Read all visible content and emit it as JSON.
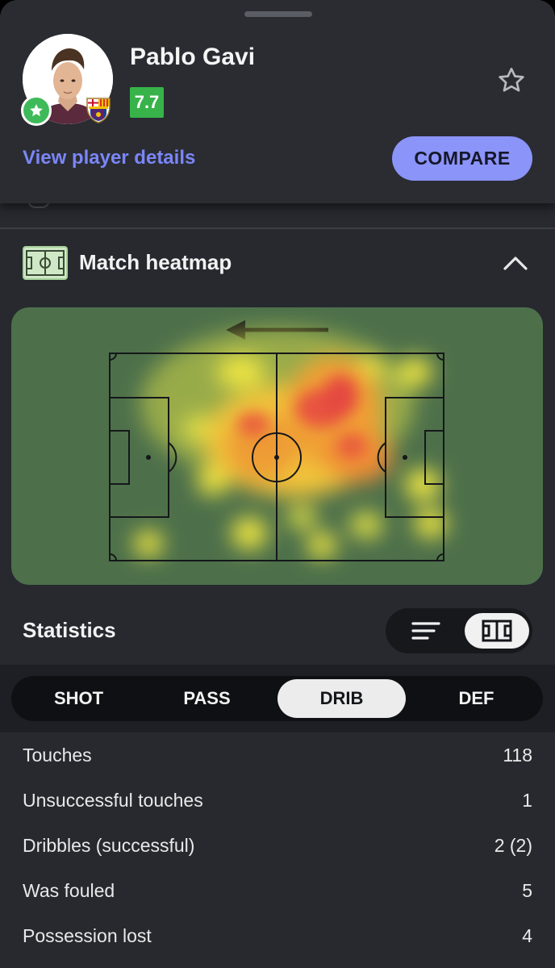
{
  "player": {
    "name": "Pablo Gavi",
    "rating": "7.7",
    "details_link": "View player details",
    "compare_label": "COMPARE"
  },
  "heatmap": {
    "title": "Match heatmap",
    "attack_direction": "left"
  },
  "statistics": {
    "title": "Statistics",
    "tabs": [
      {
        "label": "SHOT",
        "active": false
      },
      {
        "label": "PASS",
        "active": false
      },
      {
        "label": "DRIB",
        "active": true
      },
      {
        "label": "DEF",
        "active": false
      }
    ],
    "rows": [
      {
        "label": "Touches",
        "value": "118"
      },
      {
        "label": "Unsuccessful touches",
        "value": "1"
      },
      {
        "label": "Dribbles (successful)",
        "value": "2 (2)"
      },
      {
        "label": "Was fouled",
        "value": "5"
      },
      {
        "label": "Possession lost",
        "value": "4"
      }
    ]
  },
  "colors": {
    "rating_badge": "#37b34a",
    "accent": "#8b94f8",
    "link": "#7b86f7",
    "pitch": "#4d704b"
  },
  "icons": [
    "star-outline-icon",
    "chevron-up-icon",
    "heatmap-pitch-icon",
    "list-view-icon",
    "pitch-view-icon",
    "favorite-badge-icon",
    "club-crest-icon",
    "arrow-left-icon"
  ]
}
